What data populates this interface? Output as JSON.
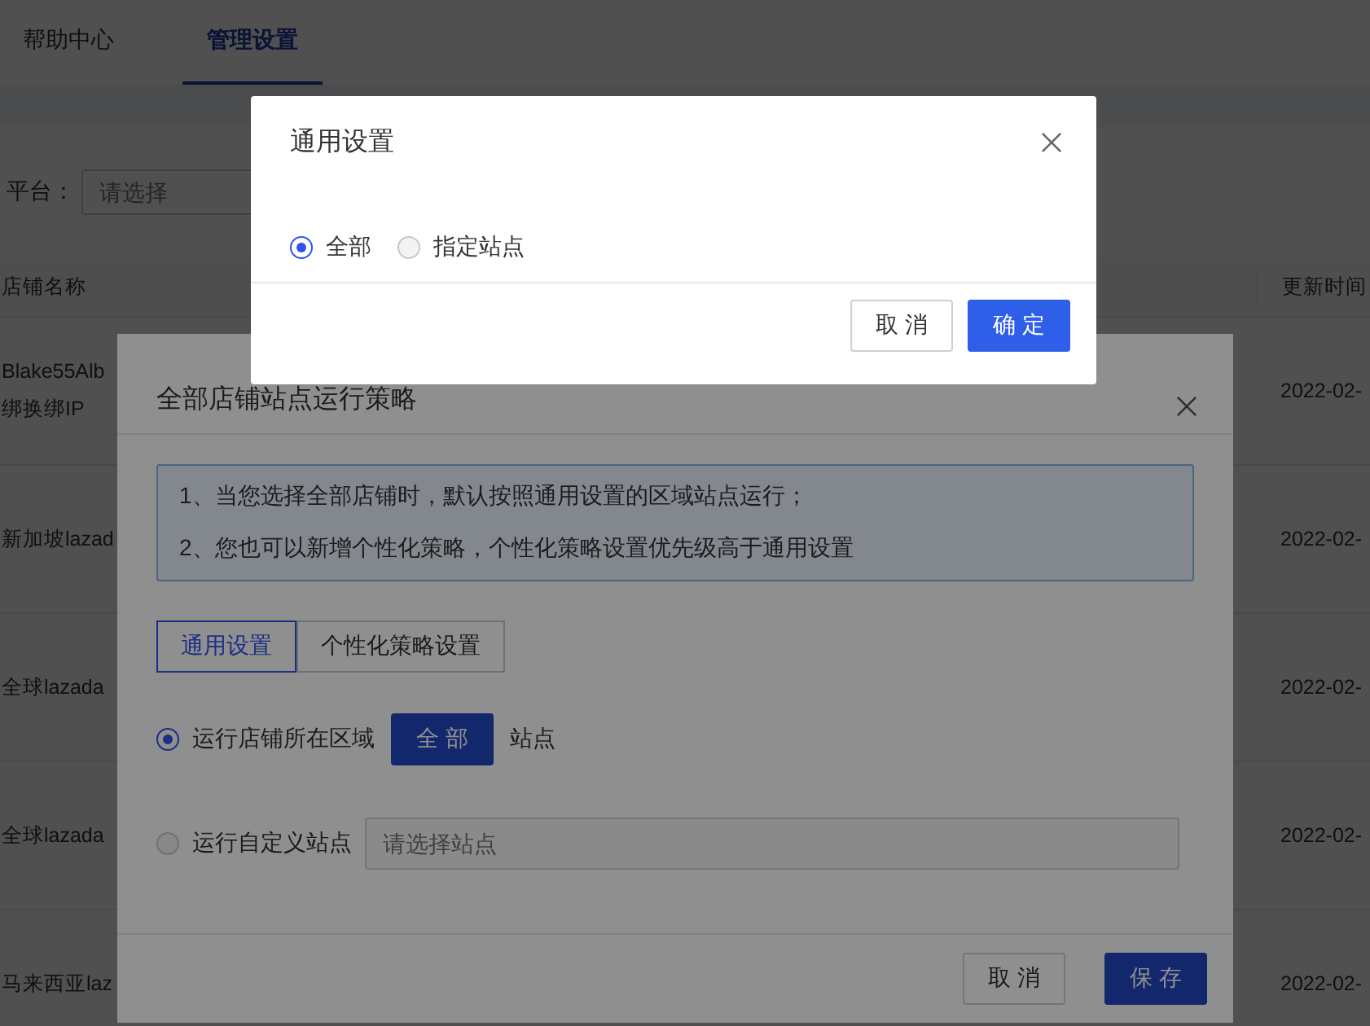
{
  "page": {
    "tabs": [
      {
        "label": "帮助中心",
        "selected": false
      },
      {
        "label": "管理设置",
        "selected": true
      }
    ],
    "filter": {
      "label": "平台：",
      "placeholder": "请选择"
    },
    "table": {
      "columns": [
        "店铺名称",
        "更新时间"
      ],
      "rows": [
        {
          "name": [
            "Blake55Alb",
            "绑换绑IP"
          ],
          "updated": "2022-02-"
        },
        {
          "name": [
            "新加坡lazad"
          ],
          "updated": "2022-02-"
        },
        {
          "name": [
            "全球lazada"
          ],
          "updated": "2022-02-"
        },
        {
          "name": [
            "全球lazada"
          ],
          "updated": "2022-02-"
        },
        {
          "name": [
            "马来西亚laz"
          ],
          "updated": "2022-02-"
        }
      ]
    }
  },
  "strategy_dialog": {
    "title": "全部店铺站点运行策略",
    "notes": [
      "1、当您选择全部店铺时，默认按照通用设置的区域站点运行；",
      "2、您也可以新增个性化策略，个性化策略设置优先级高于通用设置"
    ],
    "tabs": [
      {
        "label": "通用设置",
        "selected": true
      },
      {
        "label": "个性化策略设置",
        "selected": false
      }
    ],
    "options": [
      {
        "kind": "button",
        "label": "运行店铺所在区域",
        "selected": true,
        "button": "全 部",
        "suffix": "站点"
      },
      {
        "kind": "select",
        "label": "运行自定义站点",
        "selected": false,
        "placeholder": "请选择站点"
      }
    ],
    "buttons": [
      {
        "label": "取 消",
        "kind": "default"
      },
      {
        "label": "保 存",
        "kind": "primary"
      }
    ]
  },
  "general_dialog": {
    "title": "通用设置",
    "options": [
      {
        "label": "全部",
        "selected": true
      },
      {
        "label": "指定站点",
        "selected": false
      }
    ],
    "buttons": [
      {
        "label": "取 消",
        "kind": "default"
      },
      {
        "label": "确 定",
        "kind": "primary"
      }
    ]
  }
}
